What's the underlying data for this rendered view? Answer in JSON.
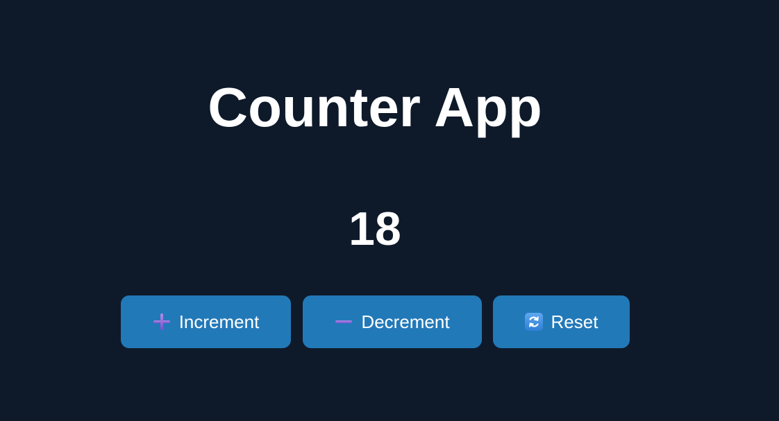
{
  "app": {
    "title": "Counter App",
    "count": "18"
  },
  "buttons": {
    "increment": {
      "label": "Increment",
      "icon": "plus-icon"
    },
    "decrement": {
      "label": "Decrement",
      "icon": "minus-icon"
    },
    "reset": {
      "label": "Reset",
      "icon": "refresh-icon"
    }
  },
  "colors": {
    "background": "#0e1a2a",
    "button": "#2279b8",
    "text": "#ffffff"
  }
}
